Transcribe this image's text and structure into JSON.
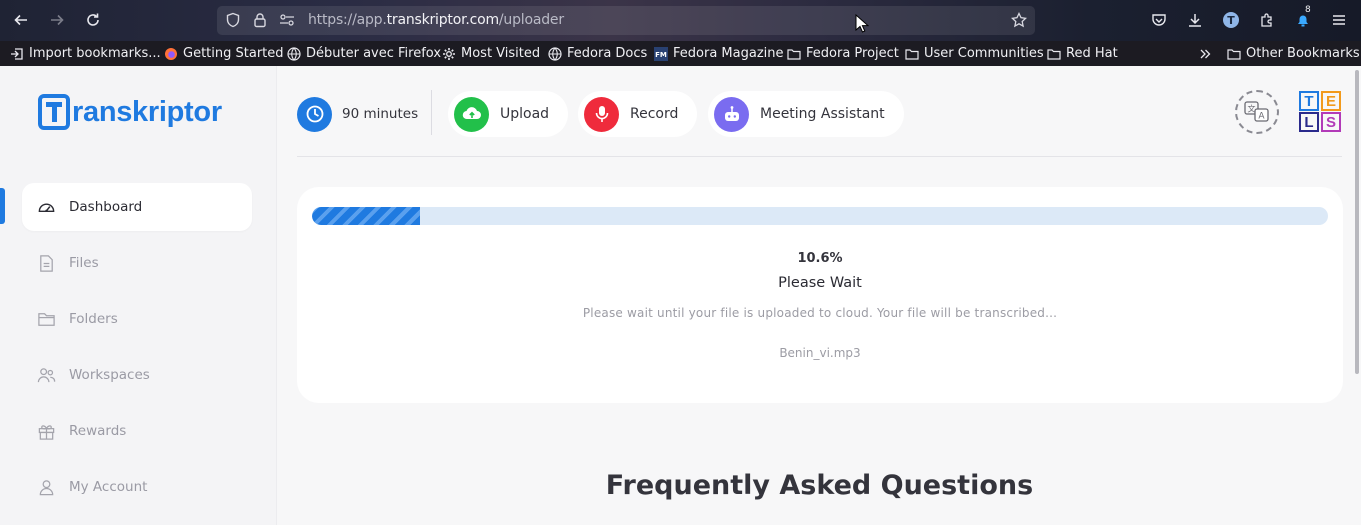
{
  "browser": {
    "url_prefix": "https://app.",
    "url_domain": "transkriptor.com",
    "url_path": "/uploader",
    "extension_badge": "8",
    "bookmarks": [
      {
        "label": "Import bookmarks...",
        "icon": "import-icon"
      },
      {
        "label": "Getting Started",
        "icon": "firefox-icon"
      },
      {
        "label": "Débuter avec Firefox",
        "icon": "globe-icon"
      },
      {
        "label": "Most Visited",
        "icon": "gear-icon"
      },
      {
        "label": "Fedora Docs",
        "icon": "globe-icon"
      },
      {
        "label": "Fedora Magazine",
        "icon": "fm-icon"
      },
      {
        "label": "Fedora Project",
        "icon": "folder-icon"
      },
      {
        "label": "User Communities",
        "icon": "folder-icon"
      },
      {
        "label": "Red Hat",
        "icon": "folder-icon"
      }
    ],
    "other_bookmarks": "Other Bookmarks"
  },
  "app": {
    "logo_text": "ranskriptor",
    "sidebar": [
      {
        "label": "Dashboard",
        "icon": "gauge-icon",
        "active": true
      },
      {
        "label": "Files",
        "icon": "file-icon",
        "active": false
      },
      {
        "label": "Folders",
        "icon": "folder-icon",
        "active": false
      },
      {
        "label": "Workspaces",
        "icon": "users-icon",
        "active": false
      },
      {
        "label": "Rewards",
        "icon": "gift-icon",
        "active": false
      },
      {
        "label": "My Account",
        "icon": "user-icon",
        "active": false
      }
    ],
    "topbar": {
      "minutes": "90 minutes",
      "upload": "Upload",
      "record": "Record",
      "meeting_assistant": "Meeting Assistant",
      "tels": [
        "T",
        "E",
        "L",
        "S"
      ]
    },
    "upload_card": {
      "progress_percent": 10.6,
      "percent_text": "10.6%",
      "status": "Please Wait",
      "description": "Please wait until your file is uploaded to cloud. Your file will be transcribed...",
      "filename": "Benin_vi.mp3"
    },
    "faq_title": "Frequently Asked Questions"
  },
  "colors": {
    "accent": "#1f7ae0",
    "upload_green": "#22c04a",
    "record_red": "#ef2b3c",
    "assistant_purple": "#7a6cf0"
  }
}
